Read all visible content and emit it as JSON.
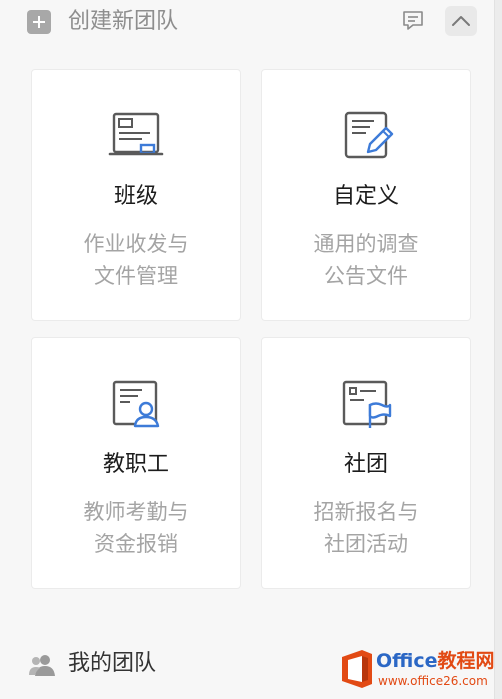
{
  "header": {
    "create_label": "创建新团队"
  },
  "cards": [
    {
      "title": "班级",
      "desc": [
        "作业收发与",
        "文件管理"
      ]
    },
    {
      "title": "自定义",
      "desc": [
        "通用的调查",
        "公告文件"
      ]
    },
    {
      "title": "教职工",
      "desc": [
        "教师考勤与",
        "资金报销"
      ]
    },
    {
      "title": "社团",
      "desc": [
        "招新报名与",
        "社团活动"
      ]
    }
  ],
  "my_teams": {
    "label": "我的团队"
  },
  "watermark": {
    "brand": "Office",
    "brand_cn": "教程网",
    "url": "www.office26.com"
  },
  "colors": {
    "accent_blue": "#3d7bd8",
    "icon_gray": "#5a5a5a",
    "watermark_orange": "#e24a14"
  }
}
